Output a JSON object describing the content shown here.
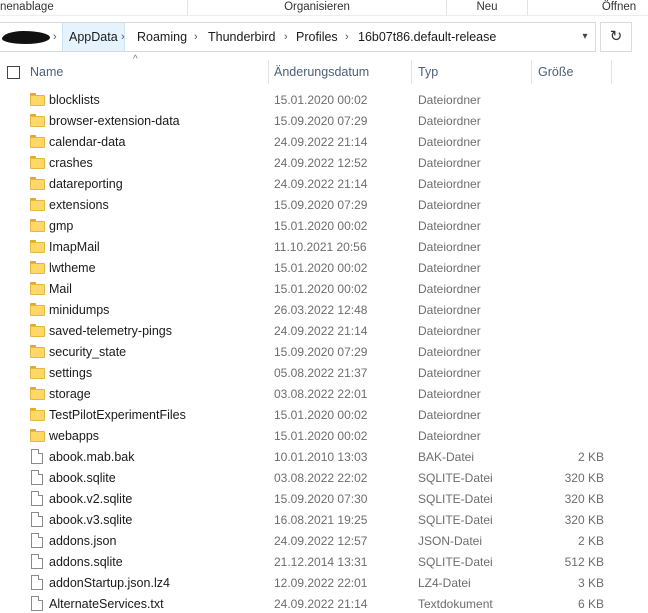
{
  "ribbon": {
    "groups": [
      "nenablage",
      "Organisieren",
      "Neu",
      "Öffnen"
    ]
  },
  "address": {
    "crumbs": [
      "AppData",
      "Roaming",
      "Thunderbird",
      "Profiles",
      "16b07t86.default-release"
    ]
  },
  "columns": {
    "name": "Name",
    "date": "Änderungsdatum",
    "type": "Typ",
    "size": "Größe"
  },
  "files": [
    {
      "name": "blocklists",
      "date": "15.01.2020 00:02",
      "type": "Dateiordner",
      "size": "",
      "icon": "folder-icon"
    },
    {
      "name": "browser-extension-data",
      "date": "15.09.2020 07:29",
      "type": "Dateiordner",
      "size": "",
      "icon": "folder-icon"
    },
    {
      "name": "calendar-data",
      "date": "24.09.2022 21:14",
      "type": "Dateiordner",
      "size": "",
      "icon": "folder-icon"
    },
    {
      "name": "crashes",
      "date": "24.09.2022 12:52",
      "type": "Dateiordner",
      "size": "",
      "icon": "folder-icon"
    },
    {
      "name": "datareporting",
      "date": "24.09.2022 21:14",
      "type": "Dateiordner",
      "size": "",
      "icon": "folder-icon"
    },
    {
      "name": "extensions",
      "date": "15.09.2020 07:29",
      "type": "Dateiordner",
      "size": "",
      "icon": "folder-icon"
    },
    {
      "name": "gmp",
      "date": "15.01.2020 00:02",
      "type": "Dateiordner",
      "size": "",
      "icon": "folder-icon"
    },
    {
      "name": "ImapMail",
      "date": "11.10.2021 20:56",
      "type": "Dateiordner",
      "size": "",
      "icon": "folder-icon"
    },
    {
      "name": "lwtheme",
      "date": "15.01.2020 00:02",
      "type": "Dateiordner",
      "size": "",
      "icon": "folder-icon"
    },
    {
      "name": "Mail",
      "date": "15.01.2020 00:02",
      "type": "Dateiordner",
      "size": "",
      "icon": "folder-icon"
    },
    {
      "name": "minidumps",
      "date": "26.03.2022 12:48",
      "type": "Dateiordner",
      "size": "",
      "icon": "folder-icon"
    },
    {
      "name": "saved-telemetry-pings",
      "date": "24.09.2022 21:14",
      "type": "Dateiordner",
      "size": "",
      "icon": "folder-icon"
    },
    {
      "name": "security_state",
      "date": "15.09.2020 07:29",
      "type": "Dateiordner",
      "size": "",
      "icon": "folder-icon"
    },
    {
      "name": "settings",
      "date": "05.08.2022 21:37",
      "type": "Dateiordner",
      "size": "",
      "icon": "folder-icon"
    },
    {
      "name": "storage",
      "date": "03.08.2022 22:01",
      "type": "Dateiordner",
      "size": "",
      "icon": "folder-icon"
    },
    {
      "name": "TestPilotExperimentFiles",
      "date": "15.01.2020 00:02",
      "type": "Dateiordner",
      "size": "",
      "icon": "folder-icon"
    },
    {
      "name": "webapps",
      "date": "15.01.2020 00:02",
      "type": "Dateiordner",
      "size": "",
      "icon": "folder-icon"
    },
    {
      "name": "abook.mab.bak",
      "date": "10.01.2010 13:03",
      "type": "BAK-Datei",
      "size": "2 KB",
      "icon": "file-icon"
    },
    {
      "name": "abook.sqlite",
      "date": "03.08.2022 22:02",
      "type": "SQLITE-Datei",
      "size": "320 KB",
      "icon": "file-icon"
    },
    {
      "name": "abook.v2.sqlite",
      "date": "15.09.2020 07:30",
      "type": "SQLITE-Datei",
      "size": "320 KB",
      "icon": "file-icon"
    },
    {
      "name": "abook.v3.sqlite",
      "date": "16.08.2021 19:25",
      "type": "SQLITE-Datei",
      "size": "320 KB",
      "icon": "file-icon"
    },
    {
      "name": "addons.json",
      "date": "24.09.2022 12:57",
      "type": "JSON-Datei",
      "size": "2 KB",
      "icon": "file-icon"
    },
    {
      "name": "addons.sqlite",
      "date": "21.12.2014 13:31",
      "type": "SQLITE-Datei",
      "size": "512 KB",
      "icon": "file-icon"
    },
    {
      "name": "addonStartup.json.lz4",
      "date": "12.09.2022 22:01",
      "type": "LZ4-Datei",
      "size": "3 KB",
      "icon": "file-icon"
    },
    {
      "name": "AlternateServices.txt",
      "date": "24.09.2022 21:14",
      "type": "Textdokument",
      "size": "6 KB",
      "icon": "file-icon"
    }
  ]
}
